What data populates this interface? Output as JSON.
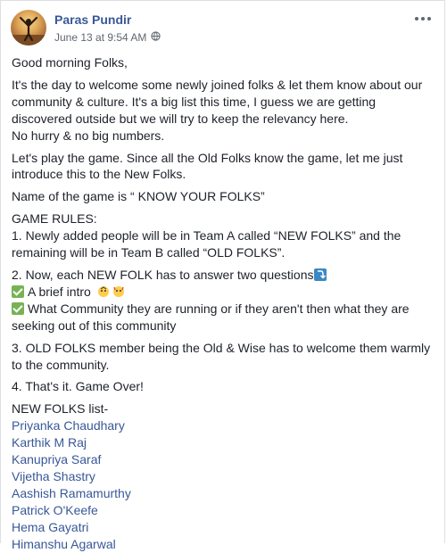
{
  "post": {
    "author": "Paras Pundir",
    "timestamp": "June 13 at 9:54 AM",
    "greeting": "Good morning Folks,",
    "intro": "It's the day to welcome some newly joined folks & let them know about our community & culture. It's a big list this time, I guess we are getting discovered outside but we will try to keep the relevancy here.",
    "intro_tail": "No hurry & no big numbers.",
    "play": "Let's play the game. Since all the Old Folks know the game, let me just introduce this to the New Folks.",
    "game_name": "Name of the game is “ KNOW YOUR FOLKS”",
    "rules_title": "GAME RULES:",
    "rule1": "1. Newly added people will be in Team A called “NEW FOLKS” and the remaining will be in Team B called “OLD FOLKS”.",
    "rule2": "2. Now, each NEW FOLK has to answer two questions",
    "rule2_a": "A brief intro",
    "rule2_b": "What Community they are running or if they aren't then what they are seeking out of this community",
    "rule3": "3. OLD FOLKS member being the Old & Wise has to welcome them warmly to the community.",
    "rule4": "4. That's it. Game Over!",
    "list_title": "NEW FOLKS list-",
    "names": [
      "Priyanka Chaudhary",
      "Karthik M Raj",
      "Kanupriya Saraf",
      "Vijetha Shastry",
      "Aashish Ramamurthy",
      "Patrick O'Keefe",
      "Hema Gayatri",
      "Himanshu Agarwal"
    ]
  },
  "icons": {
    "globe": "globe-icon",
    "more": "more-options-icon",
    "check": "check-mark-icon",
    "arrow": "arrow-down-icon",
    "emoji": "face-emoji-icon"
  },
  "colors": {
    "link": "#385898",
    "text": "#1d2129",
    "meta": "#606770",
    "check": "#77b255",
    "arrow_box": "#3b88c3"
  }
}
